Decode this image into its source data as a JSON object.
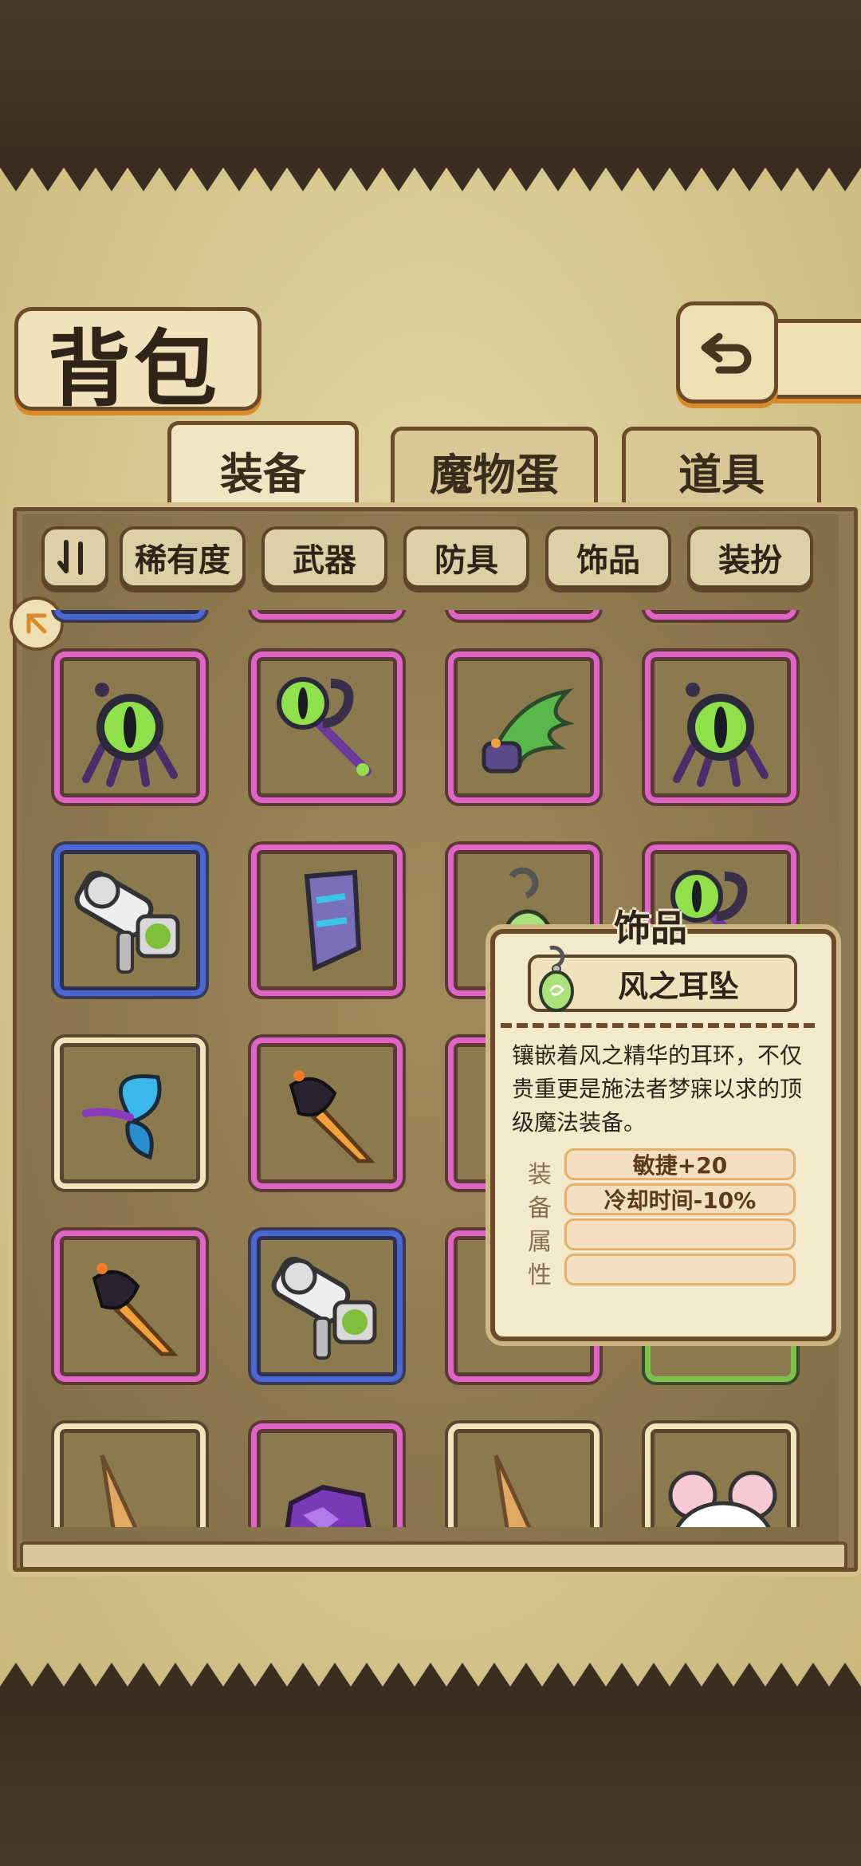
{
  "title": "背包",
  "tabs": [
    {
      "label": "装备",
      "active": true
    },
    {
      "label": "魔物蛋",
      "active": false
    },
    {
      "label": "道具",
      "active": false
    }
  ],
  "filters": [
    "稀有度",
    "武器",
    "防具",
    "饰品",
    "装扮"
  ],
  "icons": {
    "back": "back-arrow-icon",
    "sort": "sort-toggle-icon",
    "side": "arrow-badge-icon"
  },
  "rarity_colors": {
    "pink": "#e063c7",
    "blue": "#4a67d6",
    "cream": "#f2e4bd",
    "green": "#7cc24a"
  },
  "inventory": [
    {
      "item": "eye-staff",
      "rarity": "pink"
    },
    {
      "item": "eye-scepter",
      "rarity": "pink"
    },
    {
      "item": "green-claw-gauntlet",
      "rarity": "pink"
    },
    {
      "item": "eye-staff",
      "rarity": "pink"
    },
    {
      "item": "gatling-gun",
      "rarity": "blue"
    },
    {
      "item": "crystal-bracer",
      "rarity": "pink"
    },
    {
      "item": "wind-earring",
      "rarity": "pink"
    },
    {
      "item": "eye-scepter",
      "rarity": "pink"
    },
    {
      "item": "butterfly-wing",
      "rarity": "cream"
    },
    {
      "item": "flame-sword",
      "rarity": "pink"
    },
    {
      "item": "hidden",
      "rarity": "pink"
    },
    {
      "item": "hidden",
      "rarity": "pink"
    },
    {
      "item": "flame-sword",
      "rarity": "pink"
    },
    {
      "item": "gatling-gun",
      "rarity": "blue"
    },
    {
      "item": "hidden",
      "rarity": "pink"
    },
    {
      "item": "hidden",
      "rarity": "green"
    },
    {
      "item": "ice-cream-cone",
      "rarity": "cream"
    },
    {
      "item": "amethyst-armor",
      "rarity": "pink"
    },
    {
      "item": "ice-cream-cone",
      "rarity": "cream"
    },
    {
      "item": "mouse-hat",
      "rarity": "cream"
    }
  ],
  "tooltip": {
    "category": "饰品",
    "name": "风之耳坠",
    "icon": "earring-icon",
    "description": "镶嵌着风之精华的耳环，不仅贵重更是施法者梦寐以求的顶级魔法装备。",
    "stats_label": [
      "装",
      "备",
      "属",
      "性"
    ],
    "stats": [
      "敏捷+20",
      "冷却时间-10%",
      "",
      ""
    ]
  }
}
